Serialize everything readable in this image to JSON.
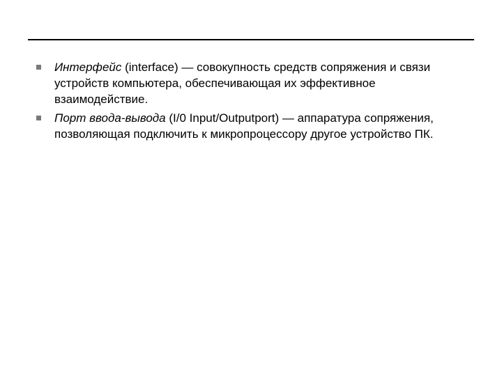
{
  "items": [
    {
      "term": "Интерфейс",
      "rest": " (interface) — совокупность средств сопряжения и связи устройств компьютера, обеспечивающая их эффективное взаимодействие."
    },
    {
      "term": "Порт ввода-вывода",
      "rest": " (I/0 Input/Outputport) — аппаратура сопряжения, позволяющая подключить к микропроцессору другое устройство ПК."
    }
  ]
}
